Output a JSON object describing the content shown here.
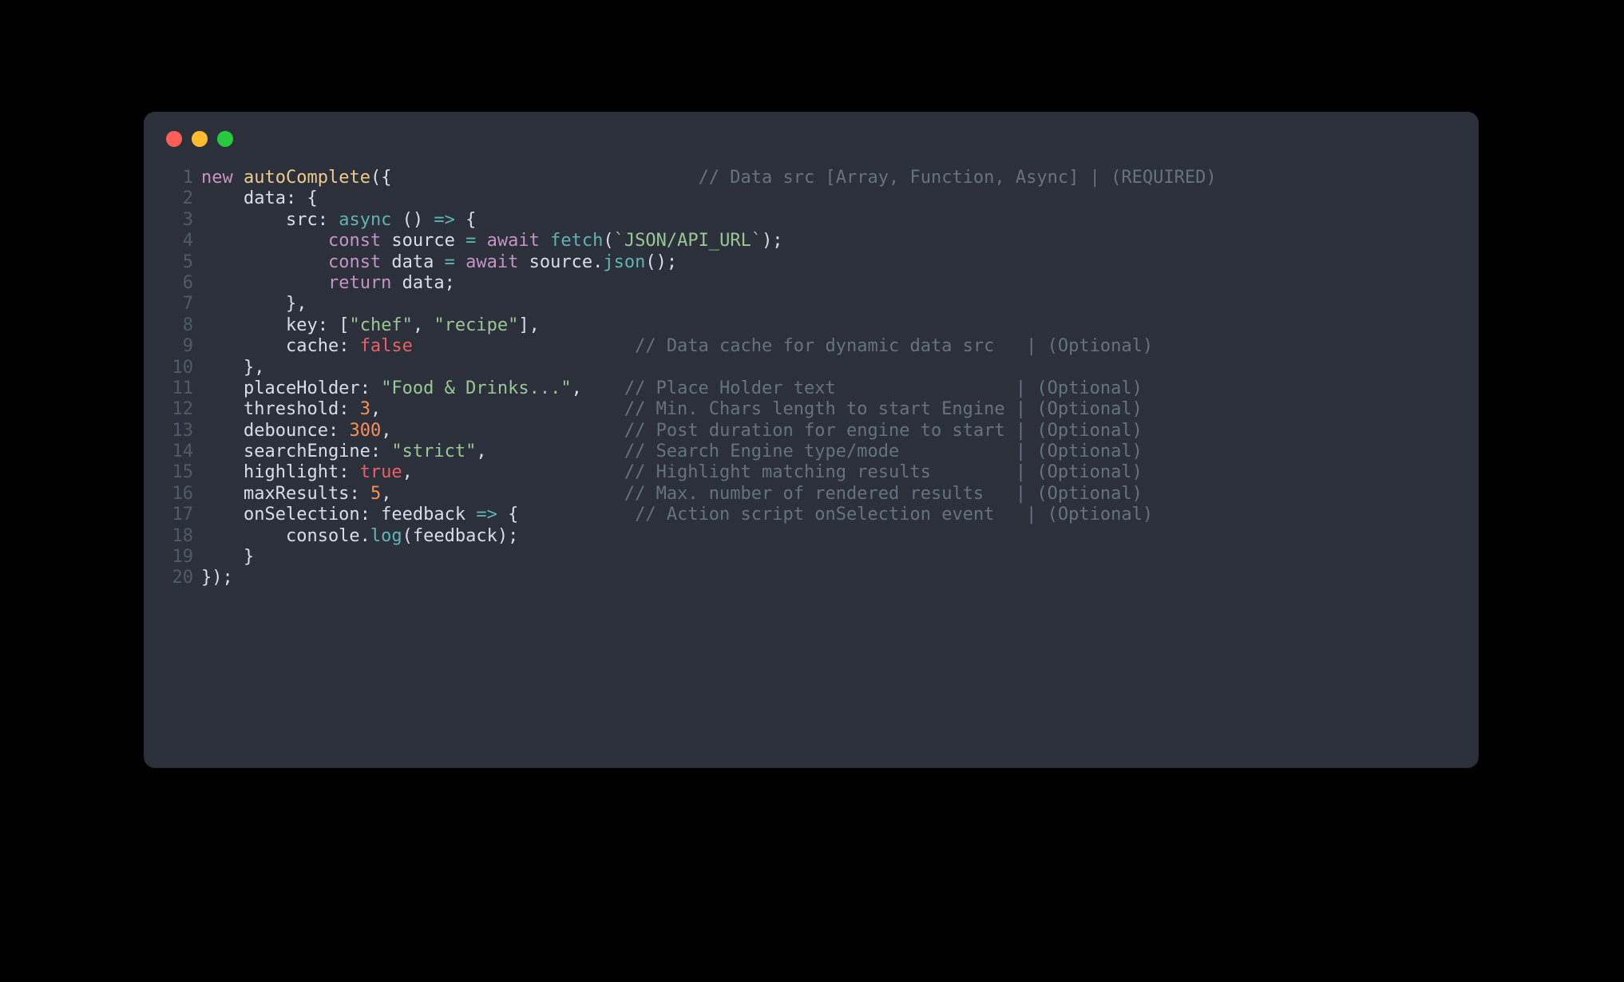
{
  "window": {
    "buttons": {
      "close": "close",
      "min": "minimize",
      "max": "maximize"
    }
  },
  "lines": {
    "l1": {
      "n": "1",
      "a": "new",
      "b": " ",
      "c": "autoComplete",
      "d": "({",
      "pad": "                             ",
      "e": "// Data src [Array, Function, Async] | (REQUIRED)"
    },
    "l2": {
      "n": "2",
      "a": "    data",
      "b": ": {"
    },
    "l3": {
      "n": "3",
      "a": "        src",
      "b": ": ",
      "c": "async",
      "d": " () ",
      "e": "=>",
      "f": " {"
    },
    "l4": {
      "n": "4",
      "a": "            ",
      "b": "const",
      "c": " source ",
      "d": "=",
      "e": " ",
      "f": "await",
      "g": " ",
      "h": "fetch",
      "i": "(",
      "j": "`JSON/API_URL`",
      "k": ");"
    },
    "l5": {
      "n": "5",
      "a": "            ",
      "b": "const",
      "c": " data ",
      "d": "=",
      "e": " ",
      "f": "await",
      "g": " source.",
      "h": "json",
      "i": "();"
    },
    "l6": {
      "n": "6",
      "a": "            ",
      "b": "return",
      "c": " data;"
    },
    "l7": {
      "n": "7",
      "a": "        },"
    },
    "l8": {
      "n": "8",
      "a": "        key",
      "b": ": [",
      "c": "\"chef\"",
      "d": ", ",
      "e": "\"recipe\"",
      "f": "],"
    },
    "l9": {
      "n": "9",
      "a": "        cache",
      "b": ": ",
      "c": "false",
      "pad": "                     ",
      "d": "// Data cache for dynamic data src   | (Optional)"
    },
    "l10": {
      "n": "10",
      "a": "    },"
    },
    "l11": {
      "n": "11",
      "a": "    placeHolder",
      "b": ": ",
      "c": "\"Food & Drinks...\"",
      "d": ",",
      "pad": "    ",
      "e": "// Place Holder text                 | (Optional)"
    },
    "l12": {
      "n": "12",
      "a": "    threshold",
      "b": ": ",
      "c": "3",
      "d": ",",
      "pad": "                       ",
      "e": "// Min. Chars length to start Engine | (Optional)"
    },
    "l13": {
      "n": "13",
      "a": "    debounce",
      "b": ": ",
      "c": "300",
      "d": ",",
      "pad": "                      ",
      "e": "// Post duration for engine to start | (Optional)"
    },
    "l14": {
      "n": "14",
      "a": "    searchEngine",
      "b": ": ",
      "c": "\"strict\"",
      "d": ",",
      "pad": "             ",
      "e": "// Search Engine type/mode           | (Optional)"
    },
    "l15": {
      "n": "15",
      "a": "    highlight",
      "b": ": ",
      "c": "true",
      "d": ",",
      "pad": "                    ",
      "e": "// Highlight matching results        | (Optional)"
    },
    "l16": {
      "n": "16",
      "a": "    maxResults",
      "b": ": ",
      "c": "5",
      "d": ",",
      "pad": "                      ",
      "e": "// Max. number of rendered results   | (Optional)"
    },
    "l17": {
      "n": "17",
      "a": "    onSelection",
      "b": ": feedback ",
      "c": "=>",
      "d": " {",
      "pad": "           ",
      "e": "// Action script onSelection event   | (Optional)"
    },
    "l18": {
      "n": "18",
      "a": "        console.",
      "b": "log",
      "c": "(feedback);"
    },
    "l19": {
      "n": "19",
      "a": "    }"
    },
    "l20": {
      "n": "20",
      "a": "});"
    }
  }
}
